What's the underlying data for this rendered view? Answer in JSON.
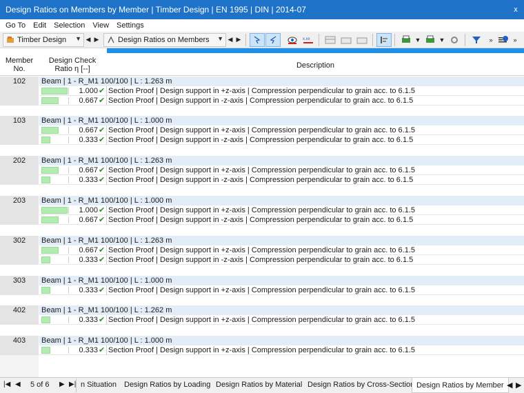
{
  "window": {
    "title": "Design Ratios on Members by Member | Timber Design | EN 1995 | DIN | 2014-07",
    "close_label": "x"
  },
  "menu": [
    "Go To",
    "Edit",
    "Selection",
    "View",
    "Settings"
  ],
  "toolbar": {
    "module_label": "Timber Design",
    "view_label": "Design Ratios on Members"
  },
  "table": {
    "headers": {
      "member": "Member\nNo.",
      "ratio": "Design Check\nRatio η [--]",
      "description": "Description"
    },
    "groups": [
      {
        "member": "102",
        "beam": "Beam | 1 - R_M1 100/100 | L : 1.263 m",
        "checks": [
          {
            "ratio": "1.000",
            "ratio_value": 1.0,
            "text": "Section Proof | Design support in +z-axis | Compression perpendicular to grain acc. to 6.1.5"
          },
          {
            "ratio": "0.667",
            "ratio_value": 0.667,
            "text": "Section Proof | Design support in -z-axis | Compression perpendicular to grain acc. to 6.1.5"
          }
        ]
      },
      {
        "member": "103",
        "beam": "Beam | 1 - R_M1 100/100 | L : 1.000 m",
        "checks": [
          {
            "ratio": "0.667",
            "ratio_value": 0.667,
            "text": "Section Proof | Design support in +z-axis | Compression perpendicular to grain acc. to 6.1.5"
          },
          {
            "ratio": "0.333",
            "ratio_value": 0.333,
            "text": "Section Proof | Design support in -z-axis | Compression perpendicular to grain acc. to 6.1.5"
          }
        ]
      },
      {
        "member": "202",
        "beam": "Beam | 1 - R_M1 100/100 | L : 1.263 m",
        "checks": [
          {
            "ratio": "0.667",
            "ratio_value": 0.667,
            "text": "Section Proof | Design support in +z-axis | Compression perpendicular to grain acc. to 6.1.5"
          },
          {
            "ratio": "0.333",
            "ratio_value": 0.333,
            "text": "Section Proof | Design support in -z-axis | Compression perpendicular to grain acc. to 6.1.5"
          }
        ]
      },
      {
        "member": "203",
        "beam": "Beam | 1 - R_M1 100/100 | L : 1.000 m",
        "checks": [
          {
            "ratio": "1.000",
            "ratio_value": 1.0,
            "text": "Section Proof | Design support in +z-axis | Compression perpendicular to grain acc. to 6.1.5"
          },
          {
            "ratio": "0.667",
            "ratio_value": 0.667,
            "text": "Section Proof | Design support in -z-axis | Compression perpendicular to grain acc. to 6.1.5"
          }
        ]
      },
      {
        "member": "302",
        "beam": "Beam | 1 - R_M1 100/100 | L : 1.263 m",
        "checks": [
          {
            "ratio": "0.667",
            "ratio_value": 0.667,
            "text": "Section Proof | Design support in +z-axis | Compression perpendicular to grain acc. to 6.1.5"
          },
          {
            "ratio": "0.333",
            "ratio_value": 0.333,
            "text": "Section Proof | Design support in -z-axis | Compression perpendicular to grain acc. to 6.1.5"
          }
        ]
      },
      {
        "member": "303",
        "beam": "Beam | 1 - R_M1 100/100 | L : 1.000 m",
        "checks": [
          {
            "ratio": "0.333",
            "ratio_value": 0.333,
            "text": "Section Proof | Design support in +z-axis | Compression perpendicular to grain acc. to 6.1.5"
          }
        ]
      },
      {
        "member": "402",
        "beam": "Beam | 1 - R_M1 100/100 | L : 1.262 m",
        "checks": [
          {
            "ratio": "0.333",
            "ratio_value": 0.333,
            "text": "Section Proof | Design support in +z-axis | Compression perpendicular to grain acc. to 6.1.5"
          }
        ]
      },
      {
        "member": "403",
        "beam": "Beam | 1 - R_M1 100/100 | L : 1.000 m",
        "checks": [
          {
            "ratio": "0.333",
            "ratio_value": 0.333,
            "text": "Section Proof | Design support in +z-axis | Compression perpendicular to grain acc. to 6.1.5"
          }
        ]
      }
    ]
  },
  "pager": {
    "text": "5 of 6"
  },
  "tabs": [
    "n Situation",
    "Design Ratios by Loading",
    "Design Ratios by Material",
    "Design Ratios by Cross-Section",
    "Design Ratios by Member"
  ],
  "active_tab": "Design Ratios by Member",
  "colors": {
    "accent": "#1e73c8",
    "bar": "#b2ecb2",
    "check": "#2e8b2e",
    "beam_row": "#e3edf8"
  }
}
